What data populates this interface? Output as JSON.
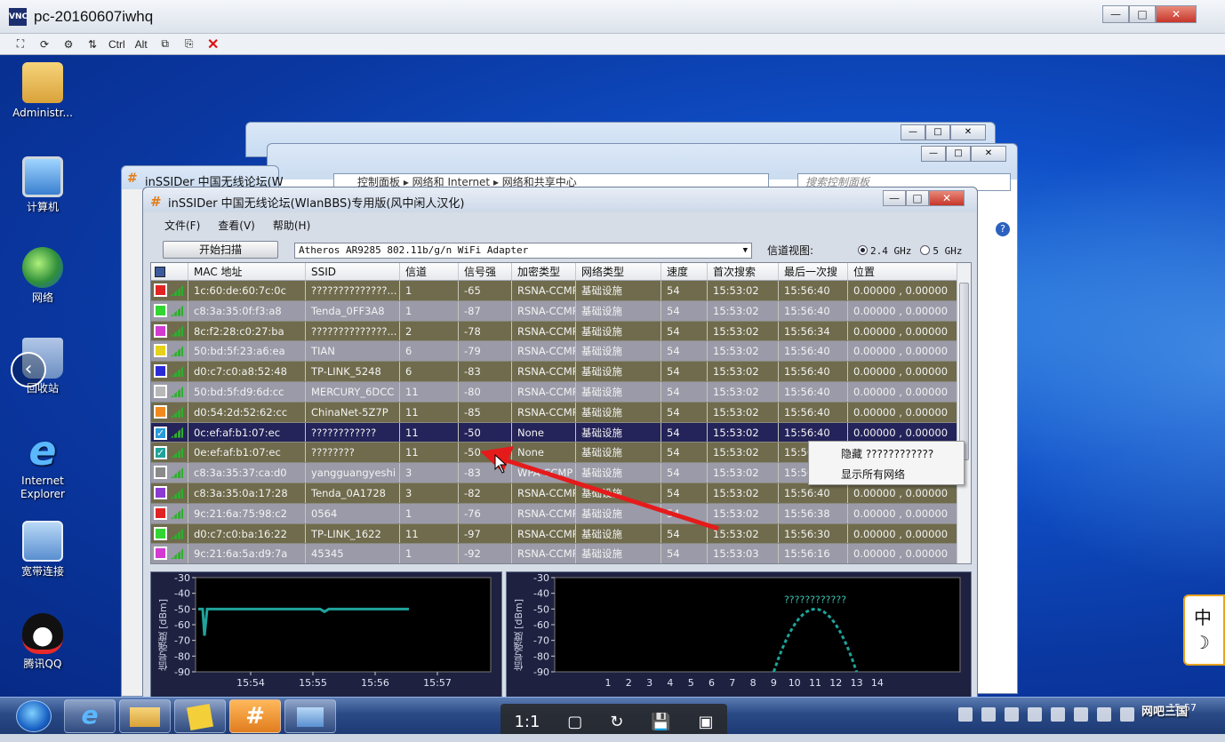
{
  "viewer": {
    "title": "pc-20160607iwhq",
    "toolbar": [
      "Ctrl",
      "Alt"
    ]
  },
  "desktop_icons": [
    {
      "label": "Administr...",
      "icon": "user-folder-icon"
    },
    {
      "label": "计算机",
      "icon": "computer-icon"
    },
    {
      "label": "网络",
      "icon": "network-globe-icon"
    },
    {
      "label": "回收站",
      "icon": "recycle-bin-icon"
    },
    {
      "label": "Internet Explorer",
      "icon": "ie-icon"
    },
    {
      "label": "宽带连接",
      "icon": "broadband-icon"
    },
    {
      "label": "腾讯QQ",
      "icon": "qq-penguin-icon"
    }
  ],
  "bg_window": {
    "title": "inSSIDer 中国无线论坛(W",
    "address_path": [
      "控制面板",
      "网络和 Internet",
      "网络和共享中心"
    ],
    "search_placeholder": "搜索控制面板"
  },
  "main_window": {
    "title": "inSSIDer 中国无线论坛(WlanBBS)专用版(风中闲人汉化)",
    "menu": [
      "文件(F)",
      "查看(V)",
      "帮助(H)"
    ],
    "scan_button": "开始扫描",
    "adapter": "Atheros AR9285 802.11b/g/n WiFi Adapter",
    "channel_view_label": "信道视图:",
    "band_24": "2.4 GHz",
    "band_5": "5 GHz"
  },
  "table": {
    "headers": [
      "MAC 地址",
      "SSID",
      "信道",
      "信号强",
      "加密类型",
      "网络类型",
      "速度",
      "首次搜索",
      "最后一次搜",
      "位置"
    ],
    "rows": [
      {
        "color": "#e02424",
        "checked": false,
        "mac": "1c:60:de:60:7c:0c",
        "ssid": "??????????????...",
        "channel": "1",
        "rssi": "-65",
        "sec": "RSNA-CCMP",
        "type": "基础设施",
        "speed": "54",
        "first": "15:53:02",
        "last": "15:56:40",
        "pos": "0.00000 , 0.00000",
        "style": "olive"
      },
      {
        "color": "#32d632",
        "checked": false,
        "mac": "c8:3a:35:0f:f3:a8",
        "ssid": "Tenda_0FF3A8",
        "channel": "1",
        "rssi": "-87",
        "sec": "RSNA-CCMP",
        "type": "基础设施",
        "speed": "54",
        "first": "15:53:02",
        "last": "15:56:40",
        "pos": "0.00000 , 0.00000",
        "style": "grey"
      },
      {
        "color": "#d23ad2",
        "checked": false,
        "mac": "8c:f2:28:c0:27:ba",
        "ssid": "??????????????...",
        "channel": "2",
        "rssi": "-78",
        "sec": "RSNA-CCMP",
        "type": "基础设施",
        "speed": "54",
        "first": "15:53:02",
        "last": "15:56:34",
        "pos": "0.00000 , 0.00000",
        "style": "olive"
      },
      {
        "color": "#e6d21a",
        "checked": false,
        "mac": "50:bd:5f:23:a6:ea",
        "ssid": "TIAN",
        "channel": "6",
        "rssi": "-79",
        "sec": "RSNA-CCMP",
        "type": "基础设施",
        "speed": "54",
        "first": "15:53:02",
        "last": "15:56:40",
        "pos": "0.00000 , 0.00000",
        "style": "grey"
      },
      {
        "color": "#2a2ad8",
        "checked": false,
        "mac": "d0:c7:c0:a8:52:48",
        "ssid": "TP-LINK_5248",
        "channel": "6",
        "rssi": "-83",
        "sec": "RSNA-CCMP",
        "type": "基础设施",
        "speed": "54",
        "first": "15:53:02",
        "last": "15:56:40",
        "pos": "0.00000 , 0.00000",
        "style": "olive"
      },
      {
        "color": "#b8b8b8",
        "checked": false,
        "mac": "50:bd:5f:d9:6d:cc",
        "ssid": "MERCURY_6DCC",
        "channel": "11",
        "rssi": "-80",
        "sec": "RSNA-CCMP",
        "type": "基础设施",
        "speed": "54",
        "first": "15:53:02",
        "last": "15:56:40",
        "pos": "0.00000 , 0.00000",
        "style": "grey"
      },
      {
        "color": "#f08a1e",
        "checked": false,
        "mac": "d0:54:2d:52:62:cc",
        "ssid": "ChinaNet-5Z7P",
        "channel": "11",
        "rssi": "-85",
        "sec": "RSNA-CCMP",
        "type": "基础设施",
        "speed": "54",
        "first": "15:53:02",
        "last": "15:56:40",
        "pos": "0.00000 , 0.00000",
        "style": "olive"
      },
      {
        "color": "#2a9ad8",
        "checked": true,
        "mac": "0c:ef:af:b1:07:ec",
        "ssid": "????????????",
        "channel": "11",
        "rssi": "-50",
        "sec": "None",
        "type": "基础设施",
        "speed": "54",
        "first": "15:53:02",
        "last": "15:56:40",
        "pos": "0.00000 , 0.00000",
        "style": "selected"
      },
      {
        "color": "#1fa39a",
        "checked": true,
        "mac": "0e:ef:af:b1:07:ec",
        "ssid": "????????",
        "channel": "11",
        "rssi": "-50",
        "sec": "None",
        "type": "基础设施",
        "speed": "54",
        "first": "15:53:02",
        "last": "15:56:40",
        "pos": "0.00000 , 0.00000",
        "style": "olive"
      },
      {
        "color": "#8a8a8a",
        "checked": false,
        "mac": "c8:3a:35:37:ca:d0",
        "ssid": "yangguangyeshi",
        "channel": "3",
        "rssi": "-83",
        "sec": "WPA-CCMP",
        "type": "基础设施",
        "speed": "54",
        "first": "15:53:02",
        "last": "15:56:40",
        "pos": "0.00000 , 0.00000",
        "style": "grey"
      },
      {
        "color": "#8a3ad2",
        "checked": false,
        "mac": "c8:3a:35:0a:17:28",
        "ssid": "Tenda_0A1728",
        "channel": "3",
        "rssi": "-82",
        "sec": "RSNA-CCMP",
        "type": "基础设施",
        "speed": "54",
        "first": "15:53:02",
        "last": "15:56:40",
        "pos": "0.00000 , 0.00000",
        "style": "olive"
      },
      {
        "color": "#e02424",
        "checked": false,
        "mac": "9c:21:6a:75:98:c2",
        "ssid": "0564",
        "channel": "1",
        "rssi": "-76",
        "sec": "RSNA-CCMP",
        "type": "基础设施",
        "speed": "54",
        "first": "15:53:02",
        "last": "15:56:38",
        "pos": "0.00000 , 0.00000",
        "style": "grey"
      },
      {
        "color": "#32d632",
        "checked": false,
        "mac": "d0:c7:c0:ba:16:22",
        "ssid": "TP-LINK_1622",
        "channel": "11",
        "rssi": "-97",
        "sec": "RSNA-CCMP",
        "type": "基础设施",
        "speed": "54",
        "first": "15:53:02",
        "last": "15:56:30",
        "pos": "0.00000 , 0.00000",
        "style": "olive"
      },
      {
        "color": "#d23ad2",
        "checked": false,
        "mac": "9c:21:6a:5a:d9:7a",
        "ssid": "45345",
        "channel": "1",
        "rssi": "-92",
        "sec": "RSNA-CCMP",
        "type": "基础设施",
        "speed": "54",
        "first": "15:53:03",
        "last": "15:56:16",
        "pos": "0.00000 , 0.00000",
        "style": "grey"
      }
    ]
  },
  "context_menu": [
    "隐藏 ????????????",
    "显示所有网络"
  ],
  "graphs": {
    "ylabel": "信号强度 [dBm]",
    "y_ticks": [
      "-30",
      "-40",
      "-50",
      "-60",
      "-70",
      "-80",
      "-90"
    ],
    "time_ticks": [
      "15:54",
      "15:55",
      "15:56",
      "15:57"
    ],
    "channel_ticks": [
      "1",
      "2",
      "3",
      "4",
      "5",
      "6",
      "7",
      "8",
      "9",
      "10",
      "11",
      "12",
      "13",
      "14"
    ],
    "peak_label": "????????????",
    "line_color": "#1fa39a"
  },
  "viewer_bar": [
    "1:1",
    "▢",
    "↻",
    "💾",
    "▣"
  ],
  "ime": [
    "中",
    "☽"
  ],
  "watermark": "网吧三国",
  "clock": "15:57"
}
